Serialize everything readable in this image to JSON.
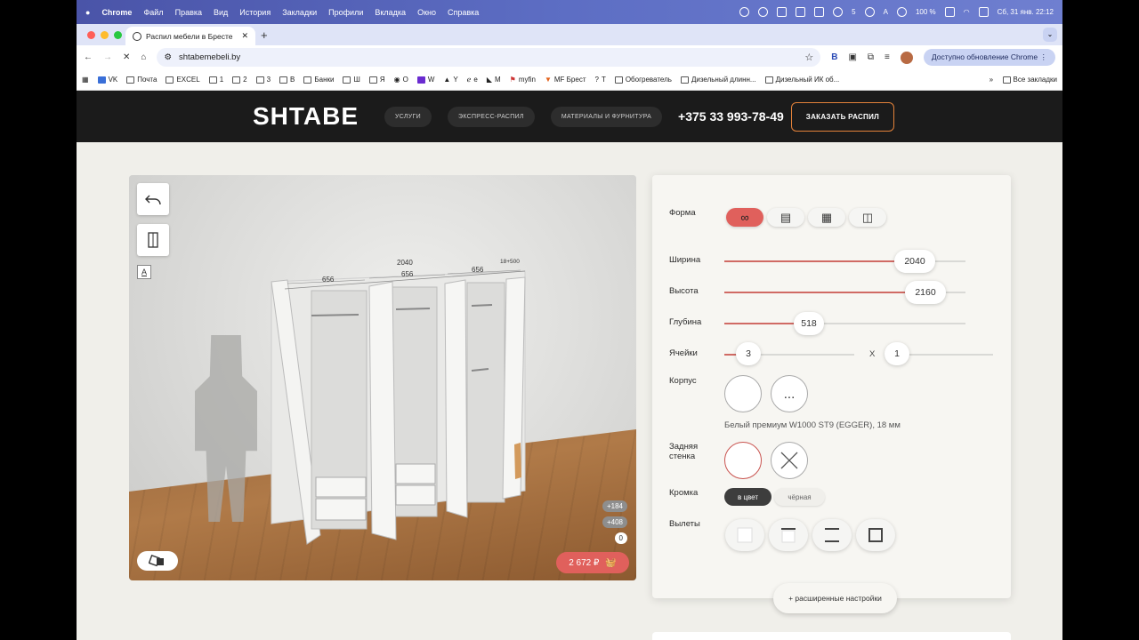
{
  "macos": {
    "app": "Chrome",
    "menu": [
      "Файл",
      "Правка",
      "Вид",
      "История",
      "Закладки",
      "Профили",
      "Вкладка",
      "Окно",
      "Справка"
    ],
    "status_count": "5",
    "input_source": "A",
    "battery": "100 %",
    "datetime": "Сб, 31 янв. 22:12"
  },
  "browser": {
    "tab_title": "Распил мебели в Бресте",
    "url": "shtabemebeli.by",
    "update_label": "Доступно обновление Chrome",
    "bookmarks": [
      "VK",
      "Почта",
      "EXCEL",
      "1",
      "2",
      "3",
      "В",
      "Банки",
      "Ш",
      "Я",
      "О",
      "W",
      "Y",
      "e",
      "M",
      "myfin",
      "MF Брест",
      "Т",
      "Обогреватель",
      "Дизельный длинн...",
      "Дизельный ИК об..."
    ],
    "all_bookmarks": "Все закладки"
  },
  "site": {
    "logo": "SHTABE",
    "nav": [
      "услуги",
      "экспресс-распил",
      "материалы и фурнитура"
    ],
    "phone": "+375 33 993-78-49",
    "order_button": "заказать распил"
  },
  "viewer": {
    "dims": {
      "total": "2040",
      "left": "656",
      "mid": "656",
      "right": "656",
      "corner": "18+500"
    },
    "counts": [
      "+184",
      "+408",
      "0"
    ],
    "price": "2 672 ₽"
  },
  "config": {
    "labels": {
      "shape": "Форма",
      "width": "Ширина",
      "height": "Высота",
      "depth": "Глубина",
      "cells": "Ячейки",
      "body": "Корпус",
      "back_line1": "Задняя",
      "back_line2": "стенка",
      "edge": "Кромка",
      "overhang": "Вылеты"
    },
    "width": {
      "value": "2040",
      "fraction": 0.78
    },
    "height": {
      "value": "2160",
      "fraction": 0.9
    },
    "depth": {
      "value": "518",
      "fraction": 0.35
    },
    "cells": {
      "value": "3",
      "x_label": "Х",
      "rows": "1"
    },
    "body_more": "...",
    "material": "Белый премиум W1000 ST9 (EGGER), 18 мм",
    "edge_options": [
      "в цвет",
      "чёрная"
    ],
    "advanced": "+ расширенные настройки"
  },
  "colors": {
    "accent": "#e0605c",
    "orange": "#e4823a",
    "dark": "#1b1b1b"
  }
}
